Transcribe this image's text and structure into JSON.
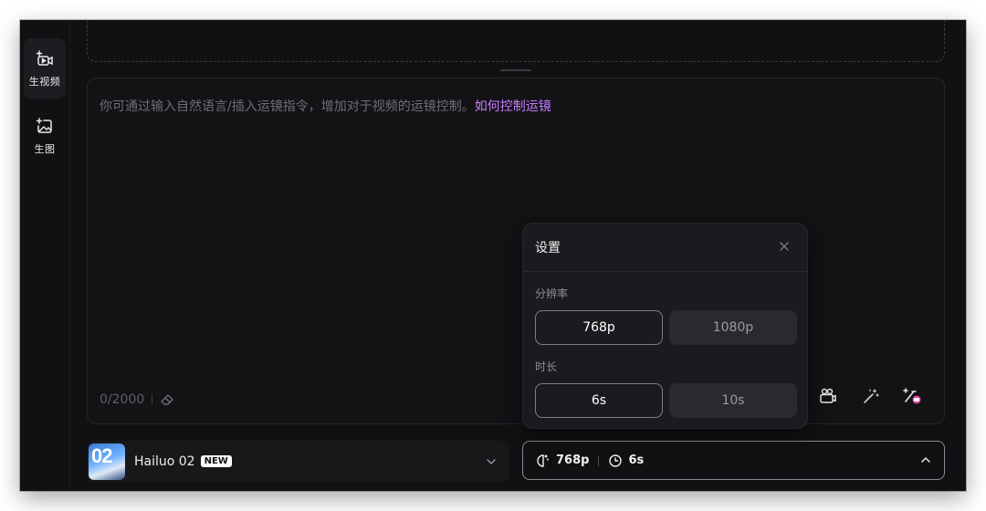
{
  "sidebar": {
    "items": [
      {
        "label": "生视频",
        "icon": "video-add-icon",
        "active": true
      },
      {
        "label": "生图",
        "icon": "image-add-icon",
        "active": false
      }
    ]
  },
  "prompt": {
    "placeholder": "你可通过输入自然语言/插入运镜指令，增加对于视频的运镜控制。",
    "help_link": "如何控制运镜",
    "counter": "0/2000"
  },
  "toolbar": {
    "icons": [
      "camera-movement-icon",
      "magic-wand-icon",
      "prompt-enhance-icon"
    ]
  },
  "model": {
    "name": "Hailuo 02",
    "badge": "NEW",
    "thumb_text": "02"
  },
  "settings_button": {
    "resolution": "768p",
    "duration": "6s"
  },
  "settings_popup": {
    "title": "设置",
    "resolution_label": "分辨率",
    "resolution_options": [
      "768p",
      "1080p"
    ],
    "resolution_selected": "768p",
    "duration_label": "时长",
    "duration_options": [
      "6s",
      "10s"
    ],
    "duration_selected": "6s"
  },
  "colors": {
    "background": "#111113",
    "accent_link": "#c77dff",
    "accent_pink": "#e83fa8"
  }
}
